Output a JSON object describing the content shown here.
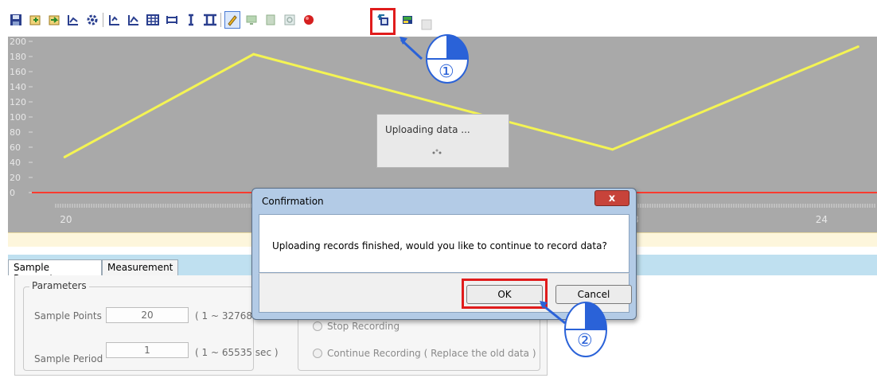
{
  "toolbar": {
    "icons": [
      "save-icon",
      "open-icon",
      "import-icon",
      "chart-line-icon",
      "settings-gear-icon",
      "chart-zoom-icon",
      "chart-compare-icon",
      "table-icon",
      "horizontal-cursor-icon",
      "single-cursor-icon",
      "double-cursor-icon",
      "draw-icon",
      "monitor-icon",
      "device-icon",
      "refresh-icon",
      "record-icon",
      "upload-icon",
      "card-icon",
      "disabled-icon"
    ]
  },
  "chart": {
    "y_ticks": [
      "200",
      "180",
      "160",
      "140",
      "120",
      "100",
      "80",
      "60",
      "40",
      "20",
      "0"
    ],
    "x_ticks": [
      "20",
      "23",
      "24"
    ],
    "colors": {
      "background": "#a9a9a9",
      "line": "#f4f453",
      "zero_line": "#ff3b2f"
    }
  },
  "chart_data": {
    "type": "line",
    "series": [
      {
        "x": [
          20,
          21,
          22.9,
          24.2
        ],
        "y": [
          47,
          183,
          57,
          193
        ]
      }
    ],
    "xlim": [
      19.7,
      24.3
    ],
    "ylim": [
      0,
      200
    ],
    "grid": false
  },
  "uploading": {
    "text": "Uploading data ..."
  },
  "tabs": [
    {
      "label": "Sample Parameter",
      "active": true
    },
    {
      "label": "Measurement",
      "active": false
    }
  ],
  "parameters": {
    "title": "Parameters",
    "sample_points_label": "Sample Points",
    "sample_points_value": "20",
    "sample_points_range": "( 1 ~ 32768",
    "sample_period_label": "Sample Period",
    "sample_period_value": "1",
    "sample_period_range": "( 1 ~ 65535 sec )"
  },
  "recording": {
    "stop_label": "Stop Recording",
    "continue_label": "Continue Recording ( Replace the old data )"
  },
  "dialog": {
    "title": "Confirmation",
    "close_label": "x",
    "message": "Uploading records finished, would you like to continue to record data?",
    "ok_label": "OK",
    "cancel_label": "Cancel"
  },
  "callouts": {
    "step1": "①",
    "step2": "②",
    "highlight_color": "#e01c1c",
    "arrow_color": "#2a62d8"
  }
}
